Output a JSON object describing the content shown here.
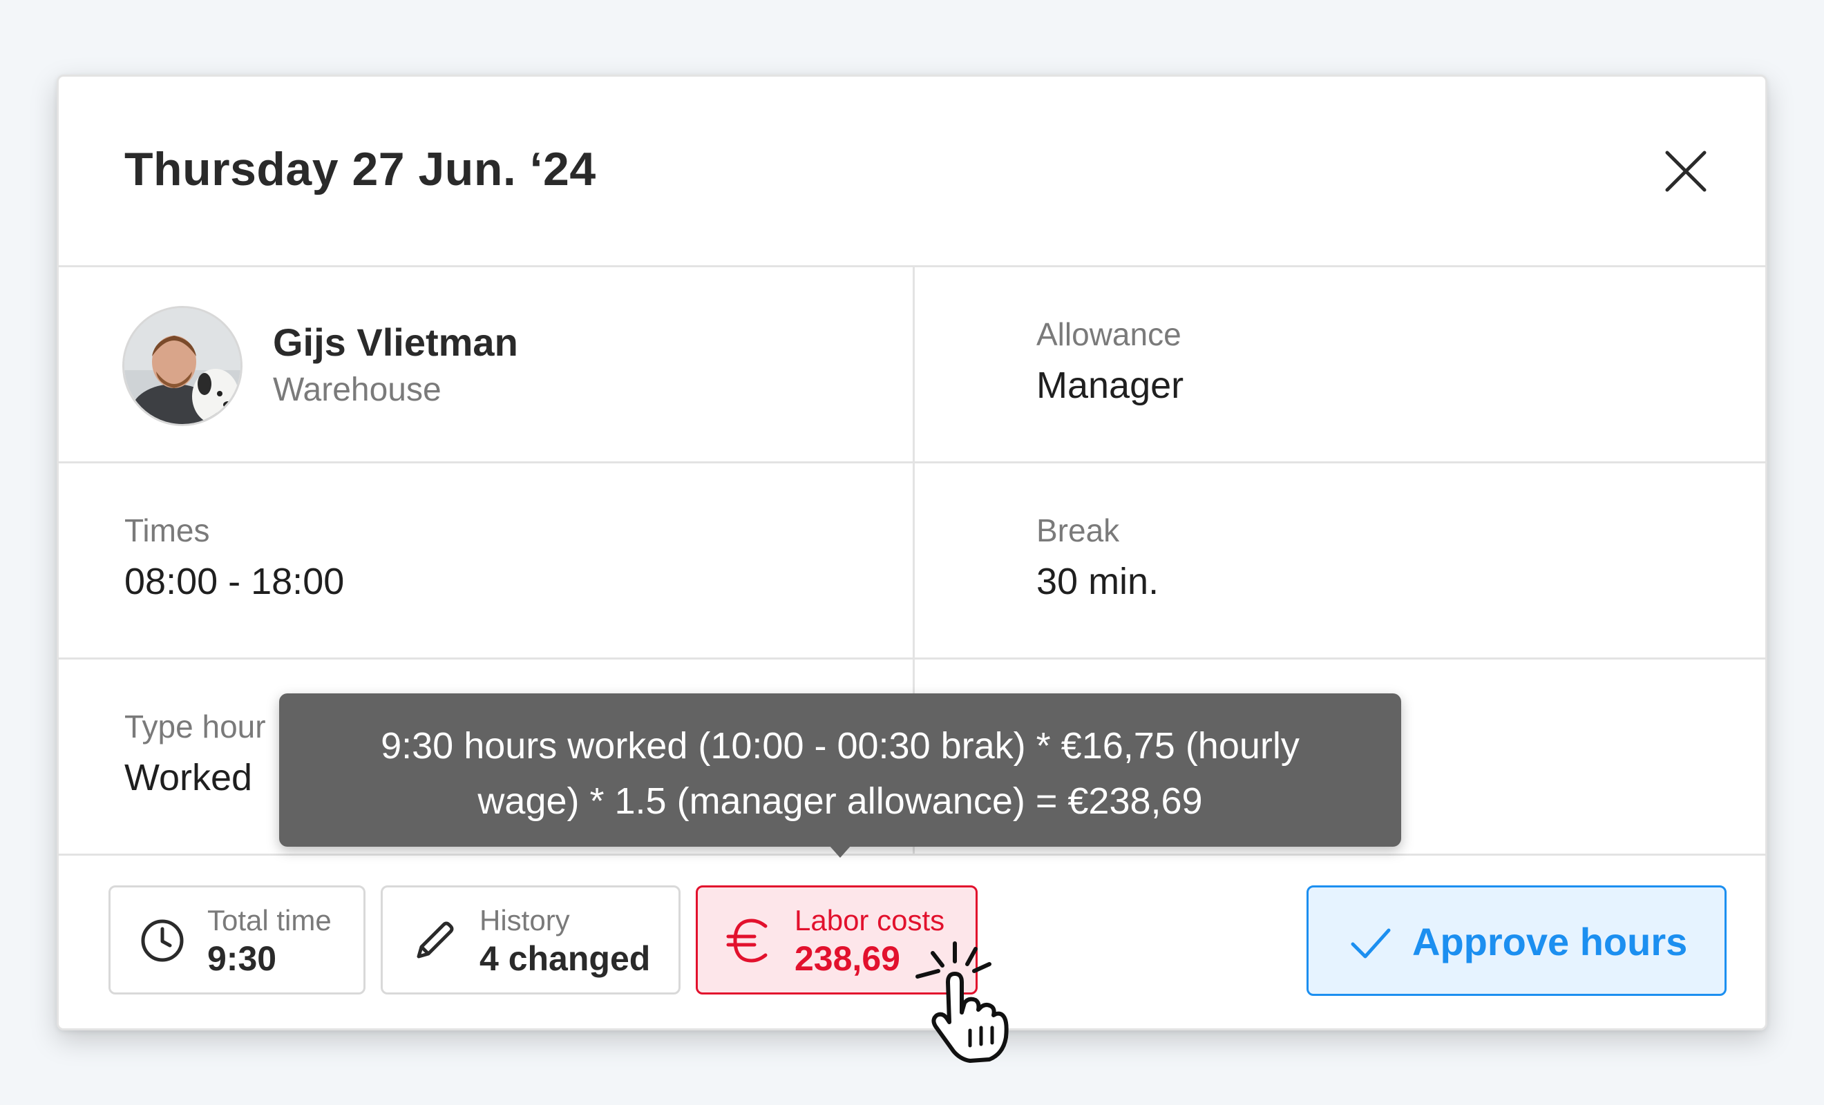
{
  "header": {
    "title": "Thursday 27 Jun. ‘24",
    "close_icon": "close-icon"
  },
  "employee": {
    "name": "Gijs Vlietman",
    "department": "Warehouse"
  },
  "allowance": {
    "label": "Allowance",
    "value": "Manager"
  },
  "times": {
    "label": "Times",
    "value": "08:00 - 18:00"
  },
  "break": {
    "label": "Break",
    "value": "30 min."
  },
  "type_hour": {
    "label": "Type hour",
    "value": "Worked"
  },
  "footer": {
    "total_time": {
      "label": "Total time",
      "value": "9:30",
      "icon": "clock-icon"
    },
    "history": {
      "label": "History",
      "value": "4 changed",
      "icon": "pencil-icon"
    },
    "labor_costs": {
      "label": "Labor costs",
      "value": "238,69",
      "icon": "euro-icon"
    },
    "approve": {
      "label": "Approve hours",
      "icon": "check-icon"
    }
  },
  "tooltip": {
    "line1": "9:30 hours worked (10:00 - 00:30 brak) * €16,75 (hourly",
    "line2": "wage) * 1.5 (manager allowance) = €238,69"
  },
  "colors": {
    "accent_blue": "#1c8ff0",
    "alert_red": "#e2112d",
    "tooltip_bg": "#636363"
  }
}
